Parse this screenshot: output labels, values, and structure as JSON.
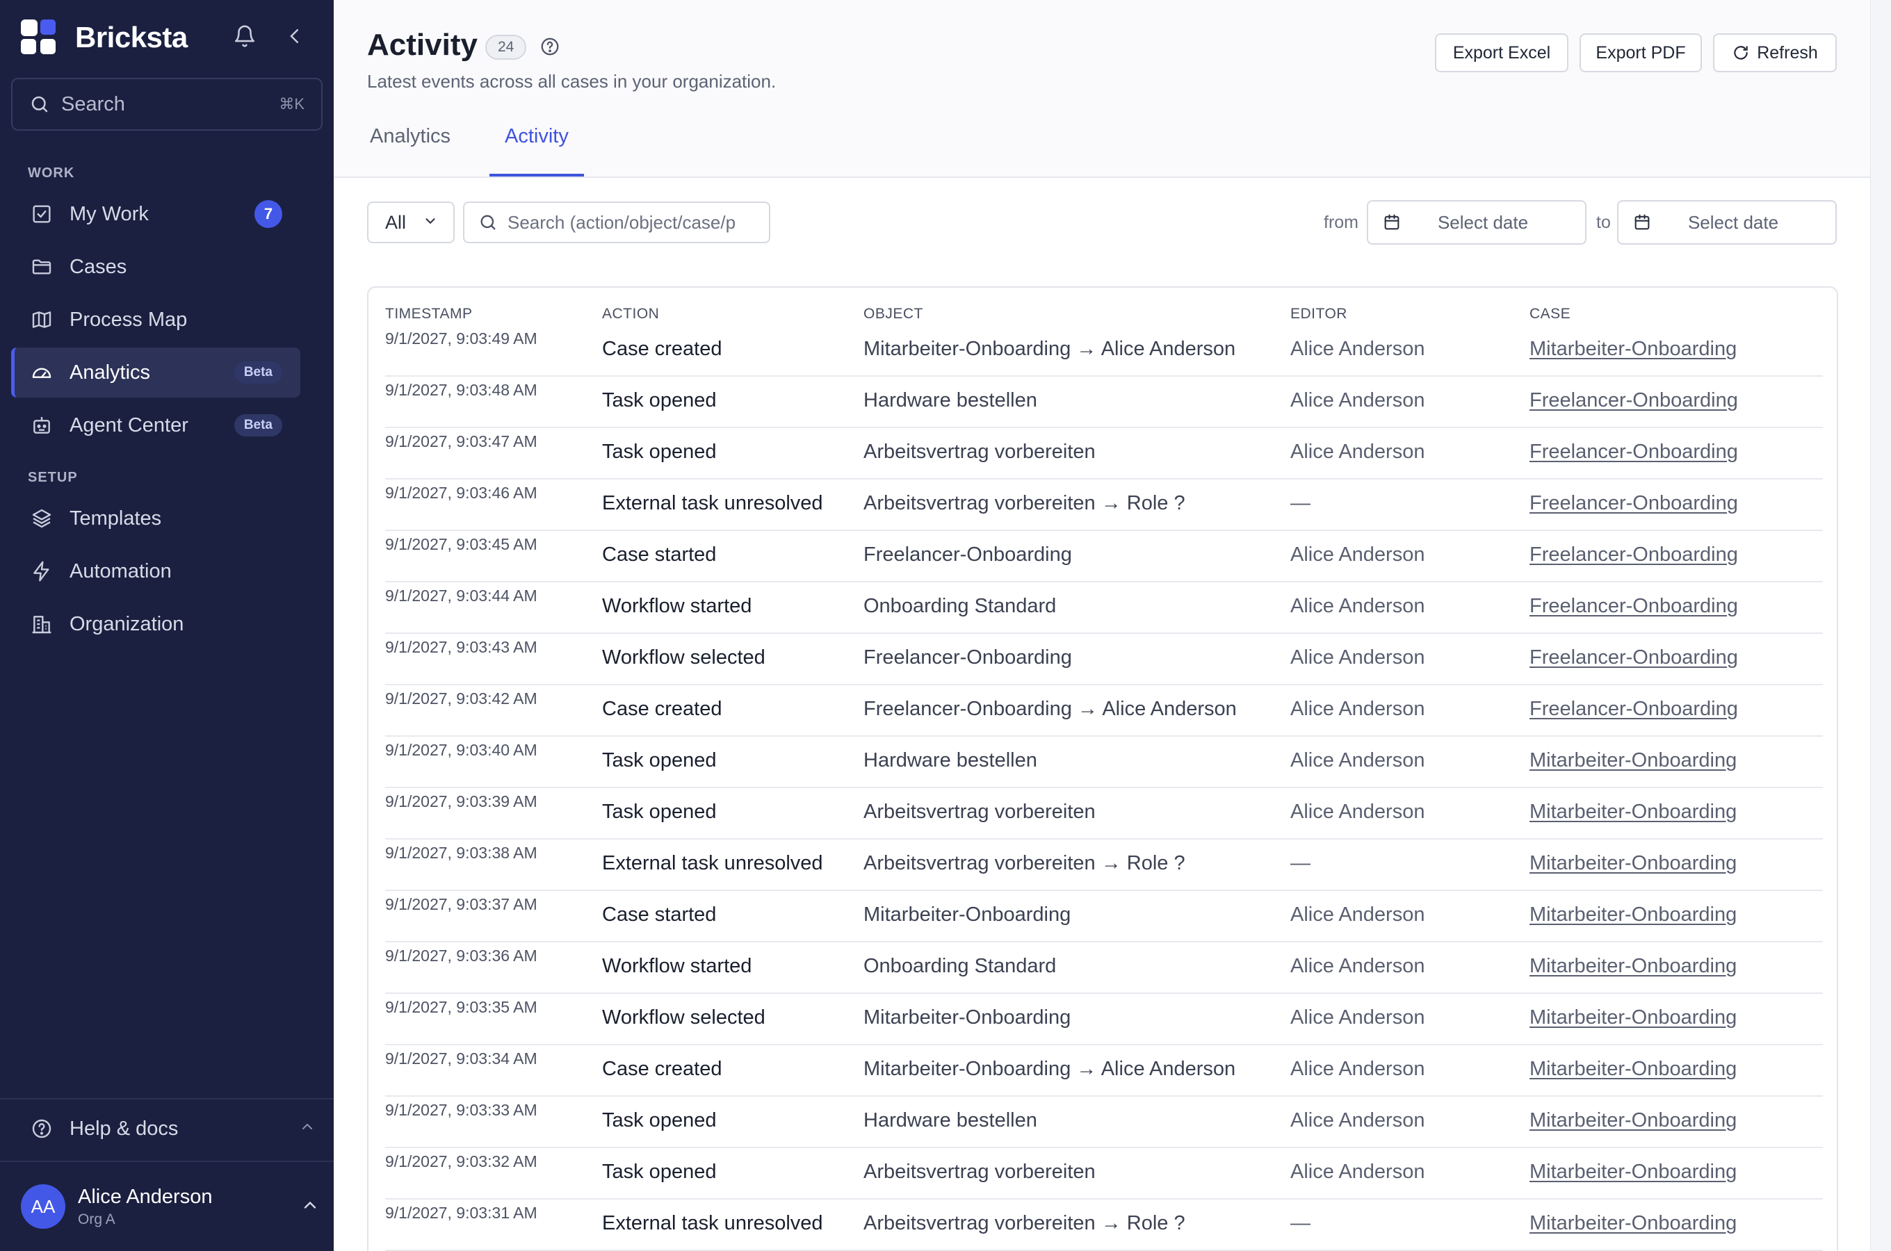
{
  "app": {
    "name": "Bricksta"
  },
  "sidebar": {
    "search": {
      "placeholder": "Search",
      "shortcut": "⌘K"
    },
    "sections": {
      "work": "WORK",
      "setup": "SETUP"
    },
    "items": [
      {
        "label": "My Work",
        "count": "7"
      },
      {
        "label": "Cases"
      },
      {
        "label": "Process Map"
      },
      {
        "label": "Analytics",
        "badge": "Beta",
        "active": true
      },
      {
        "label": "Agent Center",
        "badge": "Beta"
      },
      {
        "label": "Templates"
      },
      {
        "label": "Automation"
      },
      {
        "label": "Organization"
      }
    ],
    "help": "Help & docs",
    "user": {
      "initials": "AA",
      "name": "Alice Anderson",
      "org": "Org A"
    }
  },
  "header": {
    "title": "Activity",
    "count": "24",
    "subtitle": "Latest events across all cases in your organization.",
    "buttons": {
      "export_excel": "Export Excel",
      "export_pdf": "Export PDF",
      "refresh": "Refresh"
    },
    "tabs": [
      {
        "label": "Analytics"
      },
      {
        "label": "Activity",
        "active": true
      }
    ]
  },
  "filters": {
    "type_select": "All",
    "search_placeholder": "Search (action/object/case/p",
    "from_label": "from",
    "to_label": "to",
    "from_placeholder": "Select date",
    "to_placeholder": "Select date"
  },
  "table": {
    "columns": [
      "TIMESTAMP",
      "ACTION",
      "OBJECT",
      "EDITOR",
      "CASE"
    ],
    "rows": [
      {
        "timestamp": "9/1/2027, 9:03:49 AM",
        "action": "Case created",
        "object": "Mitarbeiter-Onboarding → Alice Anderson",
        "editor": "Alice Anderson",
        "case": "Mitarbeiter-Onboarding"
      },
      {
        "timestamp": "9/1/2027, 9:03:48 AM",
        "action": "Task opened",
        "object": "Hardware bestellen",
        "editor": "Alice Anderson",
        "case": "Freelancer-Onboarding"
      },
      {
        "timestamp": "9/1/2027, 9:03:47 AM",
        "action": "Task opened",
        "object": "Arbeitsvertrag vorbereiten",
        "editor": "Alice Anderson",
        "case": "Freelancer-Onboarding"
      },
      {
        "timestamp": "9/1/2027, 9:03:46 AM",
        "action": "External task unresolved",
        "object": "Arbeitsvertrag vorbereiten → Role ?",
        "editor": "—",
        "case": "Freelancer-Onboarding"
      },
      {
        "timestamp": "9/1/2027, 9:03:45 AM",
        "action": "Case started",
        "object": "Freelancer-Onboarding",
        "editor": "Alice Anderson",
        "case": "Freelancer-Onboarding"
      },
      {
        "timestamp": "9/1/2027, 9:03:44 AM",
        "action": "Workflow started",
        "object": "Onboarding Standard",
        "editor": "Alice Anderson",
        "case": "Freelancer-Onboarding"
      },
      {
        "timestamp": "9/1/2027, 9:03:43 AM",
        "action": "Workflow selected",
        "object": "Freelancer-Onboarding",
        "editor": "Alice Anderson",
        "case": "Freelancer-Onboarding"
      },
      {
        "timestamp": "9/1/2027, 9:03:42 AM",
        "action": "Case created",
        "object": "Freelancer-Onboarding → Alice Anderson",
        "editor": "Alice Anderson",
        "case": "Freelancer-Onboarding"
      },
      {
        "timestamp": "9/1/2027, 9:03:40 AM",
        "action": "Task opened",
        "object": "Hardware bestellen",
        "editor": "Alice Anderson",
        "case": "Mitarbeiter-Onboarding"
      },
      {
        "timestamp": "9/1/2027, 9:03:39 AM",
        "action": "Task opened",
        "object": "Arbeitsvertrag vorbereiten",
        "editor": "Alice Anderson",
        "case": "Mitarbeiter-Onboarding"
      },
      {
        "timestamp": "9/1/2027, 9:03:38 AM",
        "action": "External task unresolved",
        "object": "Arbeitsvertrag vorbereiten → Role ?",
        "editor": "—",
        "case": "Mitarbeiter-Onboarding"
      },
      {
        "timestamp": "9/1/2027, 9:03:37 AM",
        "action": "Case started",
        "object": "Mitarbeiter-Onboarding",
        "editor": "Alice Anderson",
        "case": "Mitarbeiter-Onboarding"
      },
      {
        "timestamp": "9/1/2027, 9:03:36 AM",
        "action": "Workflow started",
        "object": "Onboarding Standard",
        "editor": "Alice Anderson",
        "case": "Mitarbeiter-Onboarding"
      },
      {
        "timestamp": "9/1/2027, 9:03:35 AM",
        "action": "Workflow selected",
        "object": "Mitarbeiter-Onboarding",
        "editor": "Alice Anderson",
        "case": "Mitarbeiter-Onboarding"
      },
      {
        "timestamp": "9/1/2027, 9:03:34 AM",
        "action": "Case created",
        "object": "Mitarbeiter-Onboarding → Alice Anderson",
        "editor": "Alice Anderson",
        "case": "Mitarbeiter-Onboarding"
      },
      {
        "timestamp": "9/1/2027, 9:03:33 AM",
        "action": "Task opened",
        "object": "Hardware bestellen",
        "editor": "Alice Anderson",
        "case": "Mitarbeiter-Onboarding"
      },
      {
        "timestamp": "9/1/2027, 9:03:32 AM",
        "action": "Task opened",
        "object": "Arbeitsvertrag vorbereiten",
        "editor": "Alice Anderson",
        "case": "Mitarbeiter-Onboarding"
      },
      {
        "timestamp": "9/1/2027, 9:03:31 AM",
        "action": "External task unresolved",
        "object": "Arbeitsvertrag vorbereiten → Role ?",
        "editor": "—",
        "case": "Mitarbeiter-Onboarding"
      }
    ]
  },
  "colors": {
    "sidebar_bg": "#1b2040",
    "accent": "#3f54dd",
    "badge_bg": "#4458e8"
  }
}
